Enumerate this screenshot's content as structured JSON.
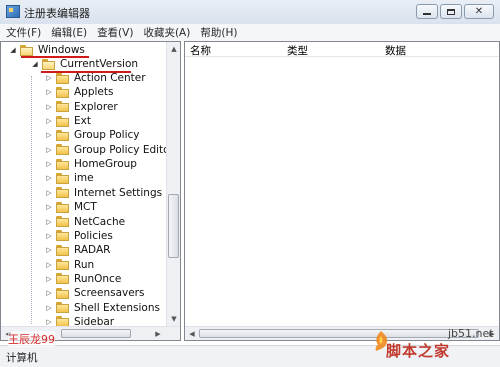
{
  "window": {
    "title": "注册表编辑器",
    "buttons": {
      "minimize": "minimize-icon",
      "maximize": "maximize-icon",
      "close": "close-icon"
    }
  },
  "menu": [
    {
      "label": "文件(F)"
    },
    {
      "label": "编辑(E)"
    },
    {
      "label": "查看(V)"
    },
    {
      "label": "收藏夹(A)"
    },
    {
      "label": "帮助(H)"
    }
  ],
  "tree": {
    "root": {
      "label": "Windows",
      "expanded": true
    },
    "selected": {
      "label": "CurrentVersion",
      "expanded": true
    },
    "children": [
      {
        "label": "Action Center"
      },
      {
        "label": "Applets"
      },
      {
        "label": "Explorer"
      },
      {
        "label": "Ext"
      },
      {
        "label": "Group Policy"
      },
      {
        "label": "Group Policy Editor"
      },
      {
        "label": "HomeGroup"
      },
      {
        "label": "ime"
      },
      {
        "label": "Internet Settings"
      },
      {
        "label": "MCT"
      },
      {
        "label": "NetCache"
      },
      {
        "label": "Policies"
      },
      {
        "label": "RADAR"
      },
      {
        "label": "Run"
      },
      {
        "label": "RunOnce"
      },
      {
        "label": "Screensavers"
      },
      {
        "label": "Shell Extensions"
      },
      {
        "label": "Sidebar"
      }
    ],
    "highlight_color": "#d11a1a"
  },
  "list": {
    "columns": [
      {
        "label": "名称"
      },
      {
        "label": "类型"
      },
      {
        "label": "数据"
      }
    ],
    "rows": []
  },
  "status": {
    "text": "计算机"
  },
  "watermarks": {
    "author": "王辰龙99",
    "site": "jb51.net",
    "logo": "脚本之家"
  }
}
